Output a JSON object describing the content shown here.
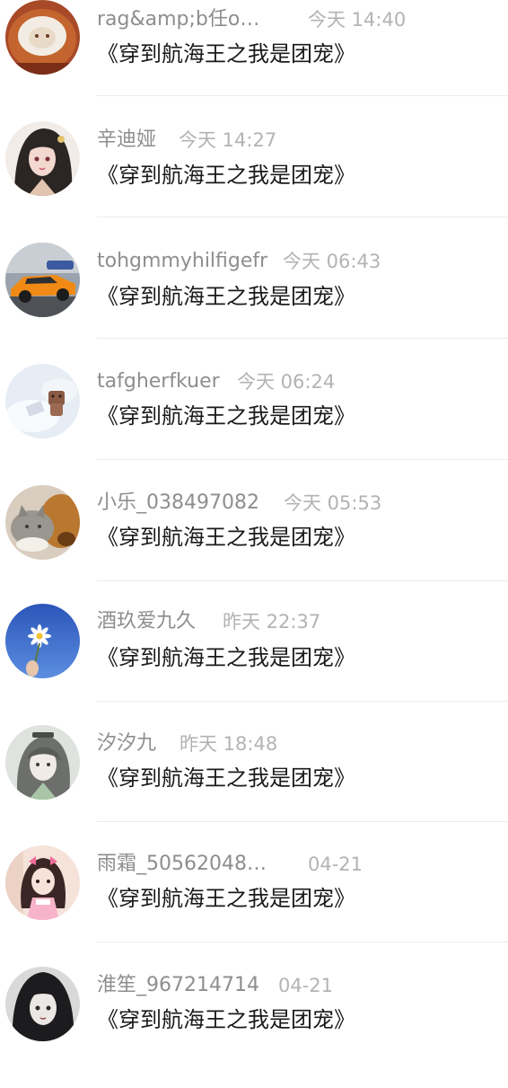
{
  "comments": [
    {
      "avatar": "latte-art-avatar",
      "name": "rag&amp;b任o…",
      "time": "今天 14:40",
      "text": "《穿到航海王之我是团宠》"
    },
    {
      "avatar": "anime-girl-avatar",
      "name": "辛迪娅",
      "time": "今天 14:27",
      "text": "《穿到航海王之我是团宠》"
    },
    {
      "avatar": "sports-car-avatar",
      "name": "tohgmmyhilfigefr",
      "time": "今天 06:43",
      "text": "《穿到航海王之我是团宠》"
    },
    {
      "avatar": "teddy-bear-avatar",
      "name": "tafgherfkuer",
      "time": "今天 06:24",
      "text": "《穿到航海王之我是团宠》"
    },
    {
      "avatar": "cat-dog-avatar",
      "name": "小乐_038497082",
      "time": "今天 05:53",
      "text": "《穿到航海王之我是团宠》"
    },
    {
      "avatar": "daisy-sky-avatar",
      "name": "酒玖爱九久",
      "time": "昨天 22:37",
      "text": "《穿到航海王之我是团宠》"
    },
    {
      "avatar": "anime-sketch-avatar",
      "name": "汐汐九",
      "time": "昨天 18:48",
      "text": "《穿到航海王之我是团宠》"
    },
    {
      "avatar": "pink-doll-avatar",
      "name": "雨霜_50562048…",
      "time": "04-21",
      "text": "《穿到航海王之我是团宠》"
    },
    {
      "avatar": "dark-hair-girl-avatar",
      "name": "淮笙_967214714",
      "time": "04-21",
      "text": "《穿到航海王之我是团宠》"
    }
  ]
}
